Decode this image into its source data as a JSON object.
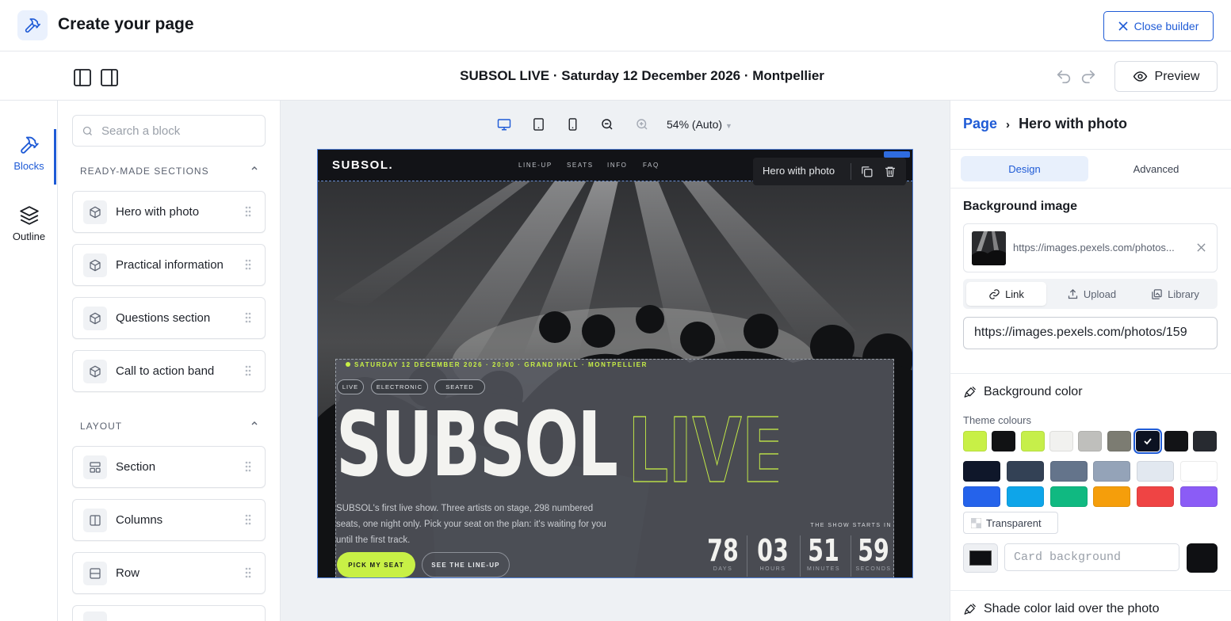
{
  "header": {
    "title": "Create your page",
    "close_label": "Close builder"
  },
  "subbar": {
    "page_title": "SUBSOL LIVE · Saturday 12 December 2026 · Montpellier",
    "preview_label": "Preview"
  },
  "rail": {
    "items": [
      {
        "label": "Blocks",
        "icon": "hammer-icon",
        "active": true
      },
      {
        "label": "Outline",
        "icon": "layers-icon",
        "active": false
      }
    ]
  },
  "blocks_panel": {
    "search_placeholder": "Search a block",
    "sections": [
      {
        "title": "READY-MADE SECTIONS",
        "items": [
          "Hero with photo",
          "Practical information",
          "Questions section",
          "Call to action band"
        ]
      },
      {
        "title": "LAYOUT",
        "items": [
          "Section",
          "Columns",
          "Row"
        ]
      }
    ]
  },
  "canvas": {
    "zoom": "54% (Auto)",
    "toolbar_label": "Hero with photo",
    "hero": {
      "brand": "SUBSOL.",
      "nav": [
        "LINE-UP",
        "SEATS",
        "INFO",
        "FAQ"
      ],
      "date_line": "SATURDAY 12 DECEMBER 2026 · 20:00 · GRAND HALL · MONTPELLIER",
      "tags": [
        "LIVE",
        "ELECTRONIC",
        "SEATED"
      ],
      "title_solid": "SUBSOL",
      "title_outline": "LIVE",
      "description": "SUBSOL's first live show. Three artists on stage, 298 numbered seats, one night only. Pick your seat on the plan: it's waiting for you until the first track.",
      "cta_primary": "PICK MY SEAT",
      "cta_secondary": "SEE THE LINE-UP",
      "countdown_label": "THE SHOW STARTS IN",
      "countdown": [
        {
          "value": "78",
          "unit": "DAYS"
        },
        {
          "value": "03",
          "unit": "HOURS"
        },
        {
          "value": "51",
          "unit": "MINUTES"
        },
        {
          "value": "59",
          "unit": "SECONDS"
        }
      ]
    }
  },
  "inspector": {
    "breadcrumb_root": "Page",
    "breadcrumb_current": "Hero with photo",
    "tabs": [
      "Design",
      "Advanced"
    ],
    "bg_image_title": "Background image",
    "image_url_short": "https://images.pexels.com/photos...",
    "source_tabs": [
      "Link",
      "Upload",
      "Library"
    ],
    "image_url_value": "https://images.pexels.com/photos/159",
    "bg_color_title": "Background color",
    "theme_label": "Theme colours",
    "swatches_row1": [
      "#c8f046",
      "#111214",
      "#c6ef4a",
      "#f1f1ef",
      "#bfbfbc",
      "#7c7c72",
      "#0c1222",
      "#121316",
      "#272a30"
    ],
    "swatches_row2": [
      "#0f172a",
      "#334155",
      "#64748b",
      "#94a3b8",
      "#e2e8f0",
      "#ffffff"
    ],
    "swatches_row3": [
      "#2563eb",
      "#0ea5e9",
      "#10b981",
      "#f59e0b",
      "#ef4444",
      "#8b5cf6"
    ],
    "transparent_label": "Transparent",
    "card_placeholder": "Card background",
    "shade_title": "Shade color laid over the photo"
  }
}
